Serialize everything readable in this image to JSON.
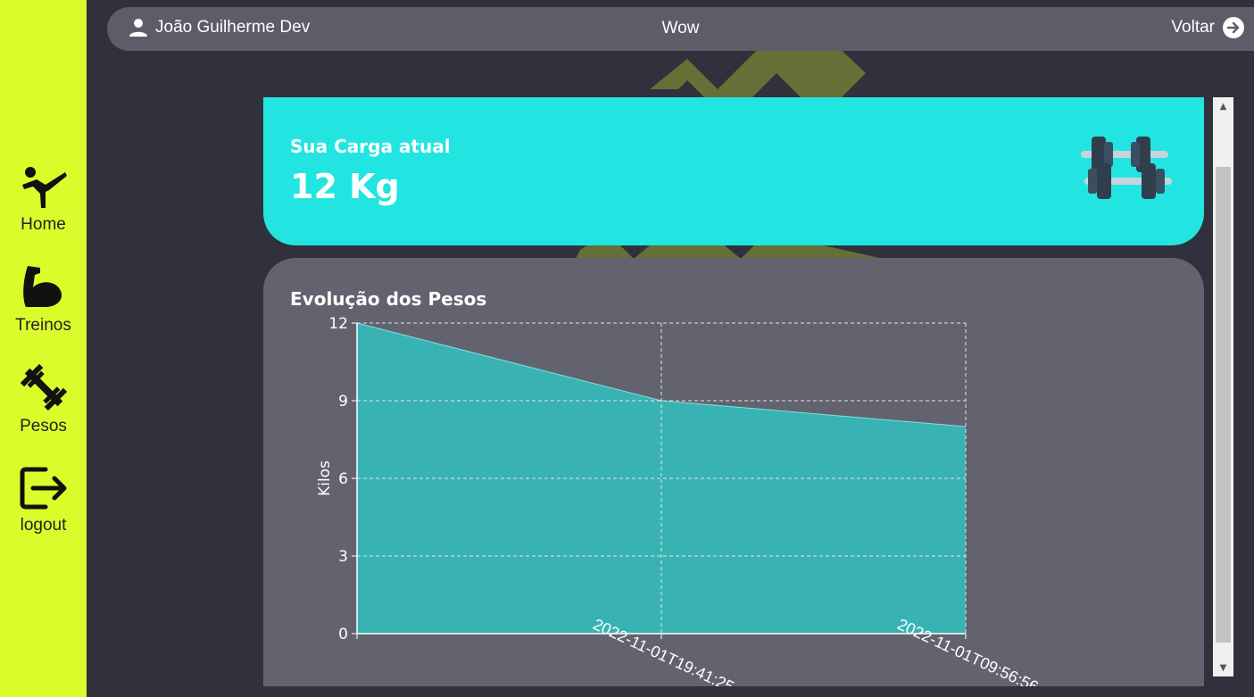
{
  "sidebar": {
    "items": [
      {
        "label": "Home",
        "icon": "martial-arts-icon"
      },
      {
        "label": "Treinos",
        "icon": "flexed-arm-icon"
      },
      {
        "label": "Pesos",
        "icon": "dumbbell-icon"
      },
      {
        "label": "logout",
        "icon": "logout-icon"
      }
    ]
  },
  "topbar": {
    "user_name": "João Guilherme Dev",
    "title": "Wow",
    "back_label": "Voltar"
  },
  "load_card": {
    "label": "Sua Carga atual",
    "value": "12 Kg"
  },
  "chart_card": {
    "title": "Evolução dos Pesos"
  },
  "colors": {
    "sidebar": "#dcfb2b",
    "accent": "#22e5e2",
    "area_fill": "#38b2b3",
    "background": "#31303d",
    "card": "#63636f"
  },
  "chart_data": {
    "type": "area",
    "x": [
      "",
      "2022-11-01T19:41:25",
      "2022-11-01T09:56:56"
    ],
    "values": [
      12,
      9,
      8
    ],
    "ylabel": "Kilos",
    "xlabel": "",
    "ylim": [
      0,
      12
    ],
    "yticks": [
      0,
      3,
      6,
      9,
      12
    ],
    "grid": true
  }
}
